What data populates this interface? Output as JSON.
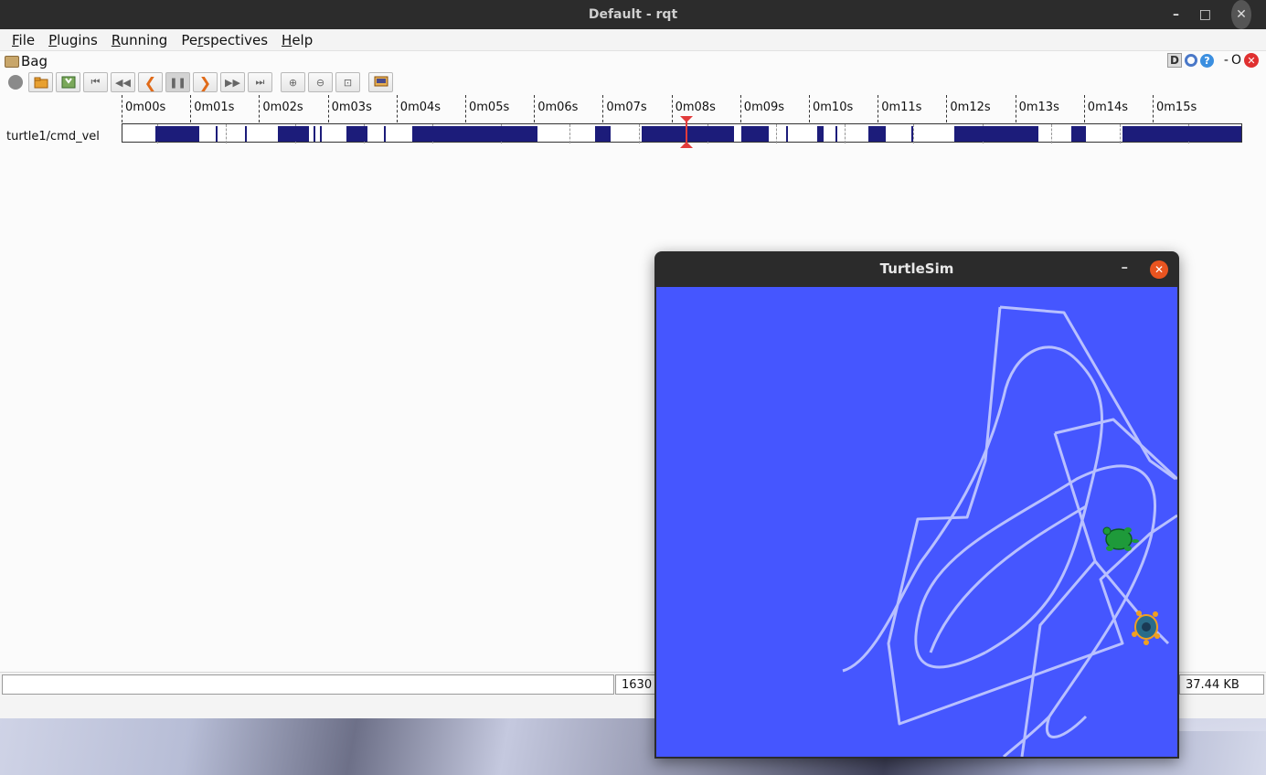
{
  "window": {
    "title": "Default - rqt",
    "minimize_glyph": "–",
    "maximize_glyph": "□",
    "close_glyph": "✕"
  },
  "menu": [
    {
      "label": "File",
      "mnemonic": "F",
      "rest": "ile"
    },
    {
      "label": "Plugins",
      "mnemonic": "P",
      "rest": "lugins"
    },
    {
      "label": "Running",
      "mnemonic": "R",
      "rest": "unning"
    },
    {
      "label": "Perspectives",
      "pre": "Pe",
      "mnemonic": "r",
      "rest": "spectives"
    },
    {
      "label": "Help",
      "mnemonic": "H",
      "rest": "elp"
    }
  ],
  "bag": {
    "title": "Bag",
    "dock": {
      "d_label": "D",
      "help_label": "?",
      "dash_label": "-",
      "o_label": "O",
      "close_label": "✕"
    },
    "toolbar_icons": [
      "record-icon",
      "open-folder-icon",
      "save-icon",
      "skip-to-start-icon",
      "rewind-icon",
      "step-back-icon",
      "pause-icon",
      "step-forward-icon",
      "fast-forward-icon",
      "skip-to-end-icon",
      "zoom-in-icon",
      "zoom-out-icon",
      "zoom-reset-icon",
      "thumbnails-icon"
    ],
    "toolbar_glyphs": [
      "",
      "",
      "",
      "⏮",
      "◀◀",
      "❮",
      "❚❚",
      "❯",
      "▶▶",
      "⏭",
      "⊕",
      "⊖",
      "⊡",
      "▤"
    ]
  },
  "timeline": {
    "ticks": [
      "0m00s",
      "0m01s",
      "0m02s",
      "0m03s",
      "0m04s",
      "0m05s",
      "0m06s",
      "0m07s",
      "0m08s",
      "0m09s",
      "0m10s",
      "0m11s",
      "0m12s",
      "0m13s",
      "0m14s",
      "0m15s"
    ],
    "topic": "turtle1/cmd_vel",
    "playhead_seconds": 8.1,
    "message_segments_seconds": [
      [
        0.48,
        1.12
      ],
      [
        1.35,
        1.38
      ],
      [
        1.78,
        1.81
      ],
      [
        2.26,
        2.71
      ],
      [
        2.78,
        2.8
      ],
      [
        2.87,
        2.89
      ],
      [
        3.26,
        3.57
      ],
      [
        3.8,
        3.82
      ],
      [
        4.22,
        6.04
      ],
      [
        6.88,
        7.1
      ],
      [
        7.55,
        8.9
      ],
      [
        9.0,
        9.4
      ],
      [
        9.65,
        9.67
      ],
      [
        10.1,
        10.2
      ],
      [
        10.37,
        10.39
      ],
      [
        10.85,
        11.1
      ],
      [
        11.47,
        11.49
      ],
      [
        12.1,
        13.32
      ],
      [
        13.8,
        14.02
      ],
      [
        14.55,
        17.0
      ]
    ]
  },
  "status": {
    "left_text": "",
    "mid_text": "1630",
    "right_text": "37.44 KB"
  },
  "turtlesim": {
    "title": "TurtleSim",
    "minimize_glyph": "–",
    "close_glyph": "✕",
    "background_color": "#4556ff"
  },
  "colors": {
    "message_bar": "#1c1c7a",
    "playhead": "#e23b3b",
    "trail": "#b8c0ff"
  }
}
